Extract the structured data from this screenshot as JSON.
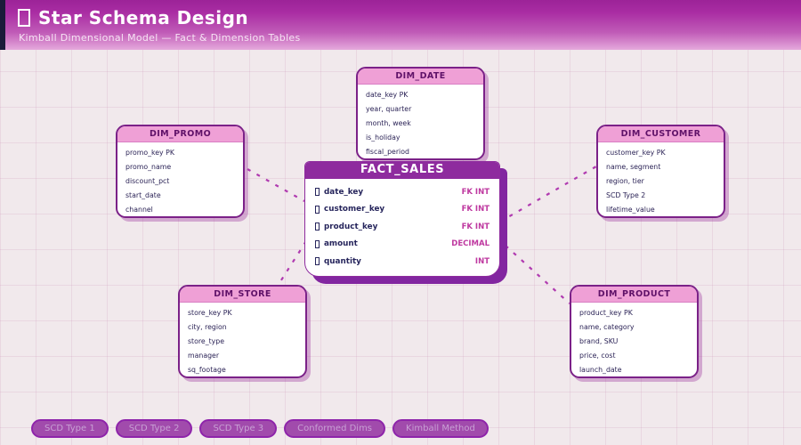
{
  "header": {
    "icon": "star-icon",
    "title": "Star Schema Design",
    "subtitle": "Kimball Dimensional Model — Fact & Dimension Tables"
  },
  "colors": {
    "header_gradient_top": "#9c2398",
    "header_gradient_bottom": "#e5a9dc",
    "accent_strip": "#1b1b3a",
    "fact_header": "#8e2b9e",
    "dim_header": "#efa0d6",
    "table_border": "#7b2188",
    "field_text": "#26255c",
    "type_text": "#bf39a0",
    "connector": "#b03ab0",
    "badge_fill": "#a14bac",
    "badge_border": "#8e24aa"
  },
  "fact_table": {
    "title": "FACT_SALES",
    "rows": [
      {
        "icon": "key-icon",
        "name": "date_key",
        "type": "FK INT"
      },
      {
        "icon": "key-icon",
        "name": "customer_key",
        "type": "FK INT"
      },
      {
        "icon": "key-icon",
        "name": "product_key",
        "type": "FK INT"
      },
      {
        "icon": "key-icon",
        "name": "amount",
        "type": "DECIMAL"
      },
      {
        "icon": "key-icon",
        "name": "quantity",
        "type": "INT"
      }
    ]
  },
  "dimension_tables": [
    {
      "id": "dim-date",
      "title": "DIM_DATE",
      "rows": [
        "date_key PK",
        "year, quarter",
        "month, week",
        "is_holiday",
        "fiscal_period"
      ]
    },
    {
      "id": "dim-promo",
      "title": "DIM_PROMO",
      "rows": [
        "promo_key PK",
        "promo_name",
        "discount_pct",
        "start_date",
        "channel"
      ]
    },
    {
      "id": "dim-customer",
      "title": "DIM_CUSTOMER",
      "rows": [
        "customer_key PK",
        "name, segment",
        "region, tier",
        "SCD Type 2",
        "lifetime_value"
      ]
    },
    {
      "id": "dim-store",
      "title": "DIM_STORE",
      "rows": [
        "store_key PK",
        "city, region",
        "store_type",
        "manager",
        "sq_footage"
      ]
    },
    {
      "id": "dim-product",
      "title": "DIM_PRODUCT",
      "rows": [
        "product_key PK",
        "name, category",
        "brand, SKU",
        "price, cost",
        "launch_date"
      ]
    }
  ],
  "badges": [
    "SCD Type 1",
    "SCD Type 2",
    "SCD Type 3",
    "Conformed Dims",
    "Kimball Method"
  ]
}
